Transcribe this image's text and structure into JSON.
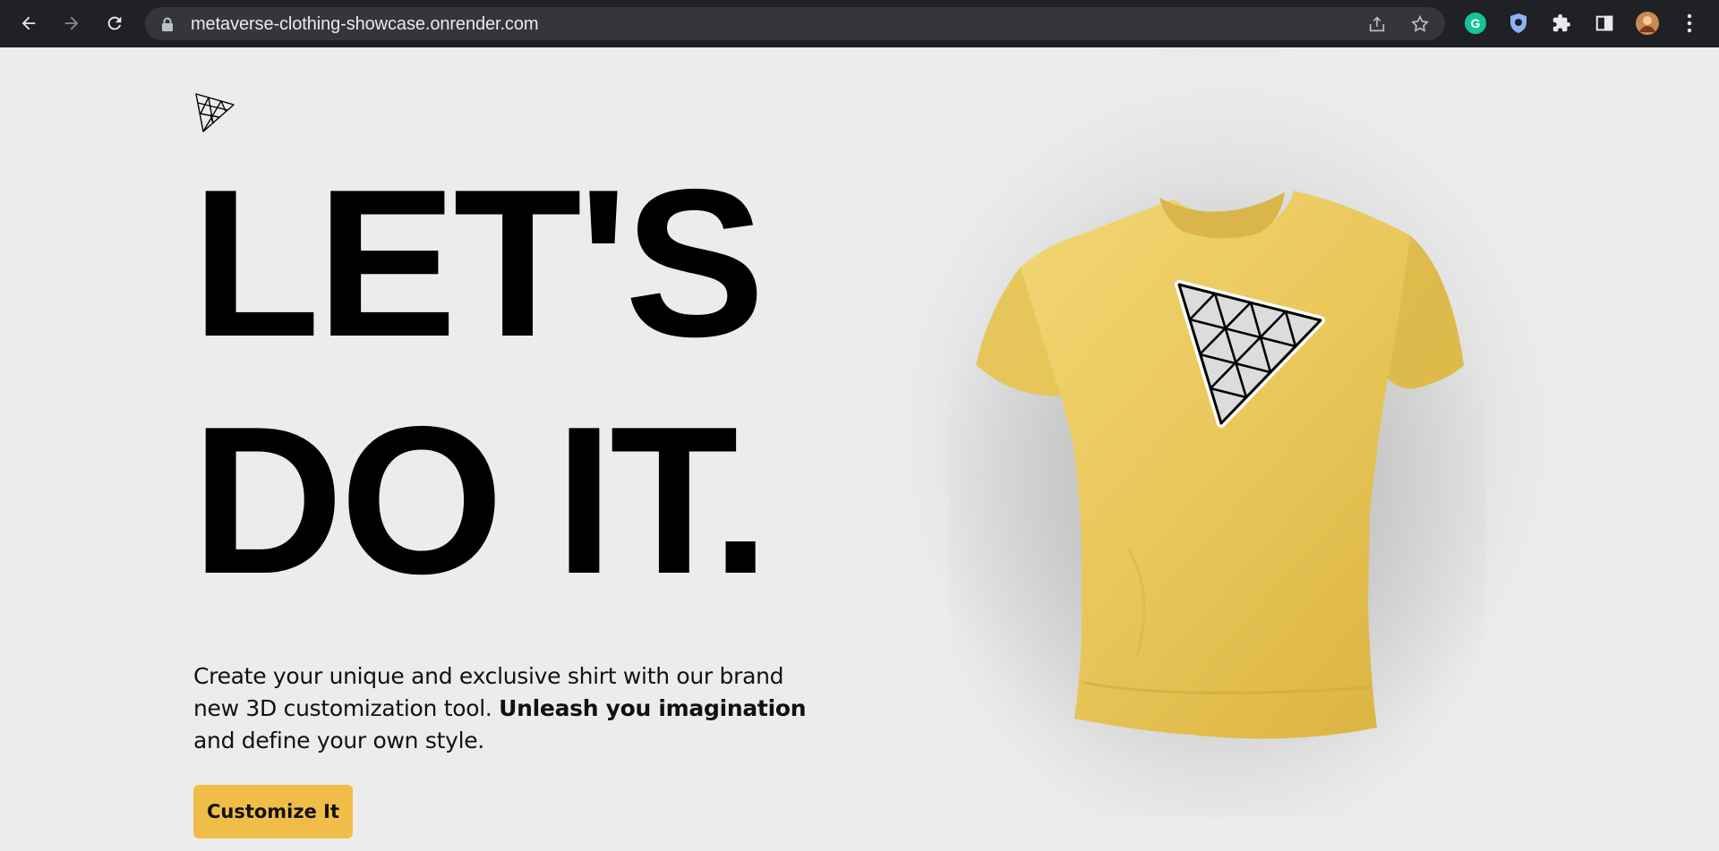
{
  "browser": {
    "url": "metaverse-clothing-showcase.onrender.com",
    "back_icon": "arrow-left-icon",
    "forward_icon": "arrow-right-icon",
    "reload_icon": "reload-icon"
  },
  "hero": {
    "headline_line1": "LET'S",
    "headline_line2": "DO IT.",
    "description_part1": "Create your unique and exclusive shirt with our brand new 3D customization tool. ",
    "description_bold": "Unleash you imagination",
    "description_part2": " and define your own style.",
    "cta_label": "Customize It"
  },
  "colors": {
    "accent": "#f0bd48",
    "shirt": "#e9c75a",
    "background": "#ececec"
  }
}
